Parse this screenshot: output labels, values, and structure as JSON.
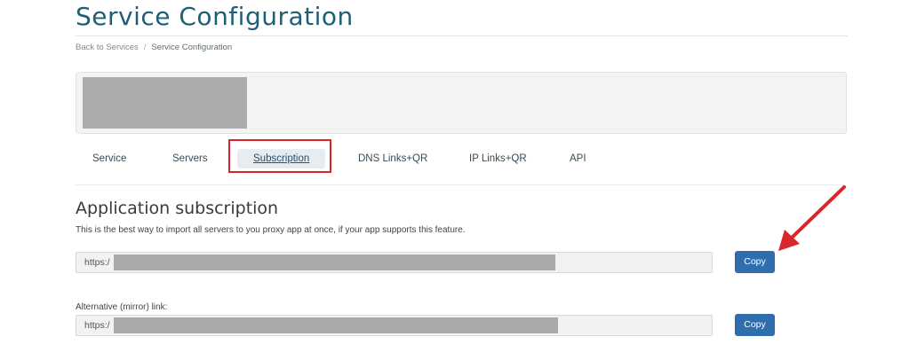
{
  "page": {
    "title": "Service Configuration"
  },
  "breadcrumb": {
    "back_label": "Back to Services",
    "separator": "/",
    "current_label": "Service Configuration"
  },
  "tabs": [
    {
      "label": "Service",
      "active": false
    },
    {
      "label": "Servers",
      "active": false
    },
    {
      "label": "Subscription",
      "active": true
    },
    {
      "label": "DNS Links+QR",
      "active": false
    },
    {
      "label": "IP Links+QR",
      "active": false
    },
    {
      "label": "API",
      "active": false
    }
  ],
  "subscription": {
    "heading": "Application subscription",
    "description": "This is the best way to import all servers to you proxy app at once, if your app supports this feature.",
    "primary_url_prefix": "https:/",
    "copy_label": "Copy",
    "alt_label": "Alternative (mirror) link:",
    "alt_url_prefix": "https:/",
    "alt_copy_label": "Copy"
  },
  "colors": {
    "title": "#1f5f76",
    "button": "#2f6eae",
    "annotation": "#d8262a",
    "redaction": "#a9a9a9"
  }
}
